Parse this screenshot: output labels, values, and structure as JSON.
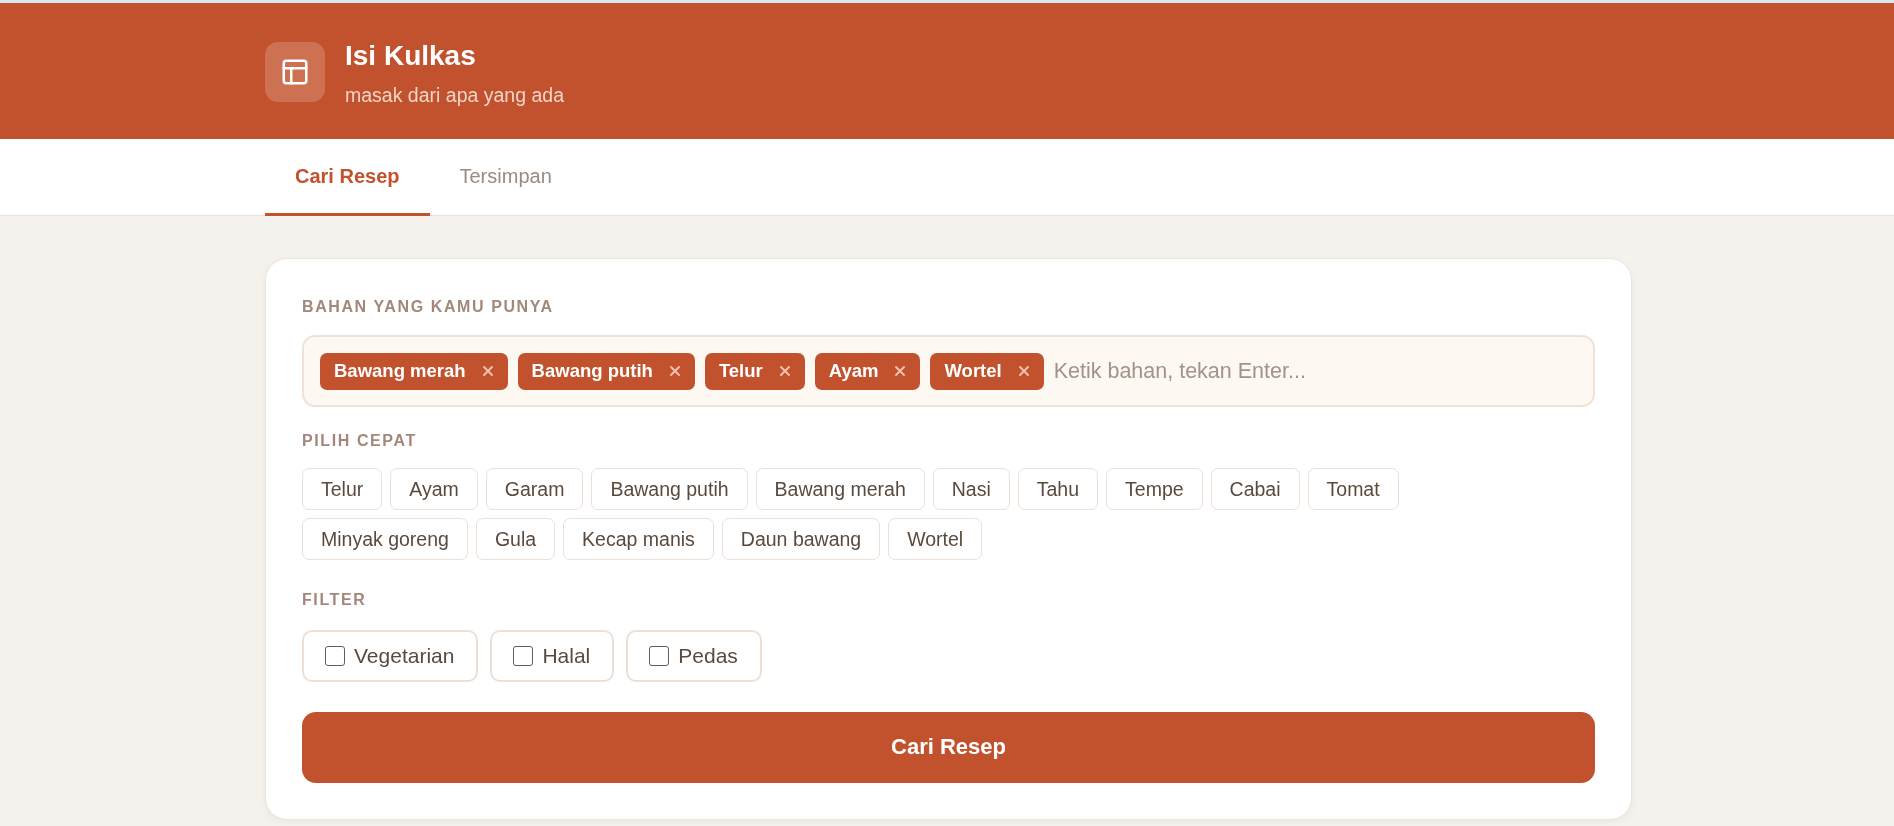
{
  "header": {
    "title": "Isi Kulkas",
    "subtitle": "masak dari apa yang ada"
  },
  "tabs": [
    {
      "label": "Cari Resep",
      "selected": true
    },
    {
      "label": "Tersimpan",
      "selected": false
    }
  ],
  "ingredients": {
    "label": "BAHAN YANG KAMU PUNYA",
    "tags": [
      "Bawang merah",
      "Bawang putih",
      "Telur",
      "Ayam",
      "Wortel"
    ],
    "placeholder": "Ketik bahan, tekan Enter..."
  },
  "quick_pick": {
    "label": "PILIH CEPAT",
    "items": [
      "Telur",
      "Ayam",
      "Garam",
      "Bawang putih",
      "Bawang merah",
      "Nasi",
      "Tahu",
      "Tempe",
      "Cabai",
      "Tomat",
      "Minyak goreng",
      "Gula",
      "Kecap manis",
      "Daun bawang",
      "Wortel"
    ]
  },
  "filter": {
    "label": "FILTER",
    "options": [
      {
        "label": "Vegetarian",
        "checked": false
      },
      {
        "label": "Halal",
        "checked": false
      },
      {
        "label": "Pedas",
        "checked": false
      }
    ]
  },
  "submit": {
    "label": "Cari Resep"
  }
}
